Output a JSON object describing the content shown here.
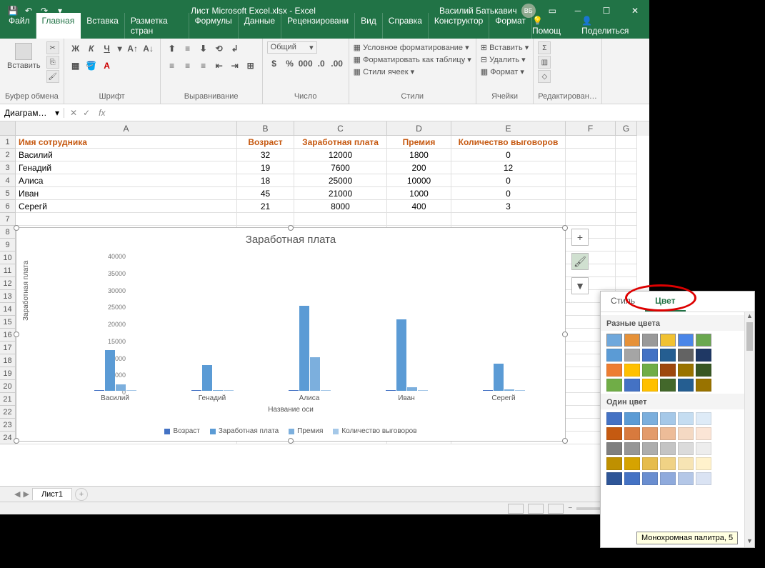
{
  "titlebar": {
    "title": "Лист Microsoft Excel.xlsx - Excel",
    "user": "Василий Батькавич",
    "initials": "ВБ"
  },
  "tabs": {
    "items": [
      "Файл",
      "Главная",
      "Вставка",
      "Разметка стран",
      "Формулы",
      "Данные",
      "Рецензировани",
      "Вид",
      "Справка",
      "Конструктор",
      "Формат"
    ],
    "active": 1,
    "help": "Помощ",
    "share": "Поделиться"
  },
  "ribbon": {
    "g1_paste": "Вставить",
    "g1": "Буфер обмена",
    "g2": "Шрифт",
    "g3": "Выравнивание",
    "g4_name": "Общий",
    "g4": "Число",
    "g5_a": "Условное форматирование",
    "g5_b": "Форматировать как таблицу",
    "g5_c": "Стили ячеек",
    "g5": "Стили",
    "g6_a": "Вставить",
    "g6_b": "Удалить",
    "g6_c": "Формат",
    "g6": "Ячейки",
    "g7": "Редактирован…"
  },
  "namebox": "Диаграм…",
  "columns": [
    "A",
    "B",
    "C",
    "D",
    "E",
    "F",
    "G"
  ],
  "headers": [
    "Имя сотрудника",
    "Возраст",
    "Заработная плата",
    "Премия",
    "Количество выговоров"
  ],
  "rows": [
    {
      "n": "Василий",
      "a": 32,
      "s": 12000,
      "b": 1800,
      "r": 0
    },
    {
      "n": "Генадий",
      "a": 19,
      "s": 7600,
      "b": 200,
      "r": 12
    },
    {
      "n": "Алиса",
      "a": 18,
      "s": 25000,
      "b": 10000,
      "r": 0
    },
    {
      "n": "Иван",
      "a": 45,
      "s": 21000,
      "b": 1000,
      "r": 0
    },
    {
      "n": "Серегй",
      "a": 21,
      "s": 8000,
      "b": 400,
      "r": 3
    }
  ],
  "chart_data": {
    "type": "bar",
    "title": "Заработная плата",
    "categories": [
      "Василий",
      "Генадий",
      "Алиса",
      "Иван",
      "Серегй"
    ],
    "series": [
      {
        "name": "Возраст",
        "values": [
          32,
          19,
          18,
          45,
          21
        ]
      },
      {
        "name": "Заработная плата",
        "values": [
          12000,
          7600,
          25000,
          21000,
          8000
        ]
      },
      {
        "name": "Премия",
        "values": [
          1800,
          200,
          10000,
          1000,
          400
        ]
      },
      {
        "name": "Количество выговоров",
        "values": [
          0,
          12,
          0,
          0,
          3
        ]
      }
    ],
    "xlabel": "Название оси",
    "ylabel": "Заработная плата",
    "yticks": [
      0,
      5000,
      10000,
      15000,
      20000,
      25000,
      30000,
      35000,
      40000
    ],
    "ylim": [
      0,
      40000
    ]
  },
  "sheet": "Лист1",
  "colorpanel": {
    "tab_style": "Стиль",
    "tab_color": "Цвет",
    "lbl_multi": "Разные цвета",
    "lbl_single": "Один цвет",
    "tooltip": "Монохромная палитра, 5",
    "multi": [
      [
        "#6fa8dc",
        "#e69138",
        "#999999",
        "#f1c232",
        "#4a86e8",
        "#6aa84f"
      ],
      [
        "#5b9bd5",
        "#a5a5a5",
        "#4472c4",
        "#255e91",
        "#636363",
        "#1f3864"
      ],
      [
        "#ed7d31",
        "#ffc000",
        "#70ad47",
        "#9e480e",
        "#997300",
        "#385723"
      ],
      [
        "#70ad47",
        "#4472c4",
        "#ffc000",
        "#43682b",
        "#255e91",
        "#997300"
      ]
    ],
    "single": [
      [
        "#4472c4",
        "#5b9bd5",
        "#7cafdd",
        "#a5c8e8",
        "#c5ddf1",
        "#deebf7"
      ],
      [
        "#c55a11",
        "#d87a3e",
        "#e39b6b",
        "#edbc98",
        "#f4d9c3",
        "#fbe5d6"
      ],
      [
        "#7f7f7f",
        "#969696",
        "#adadad",
        "#c4c4c4",
        "#dbdbdb",
        "#ededed"
      ],
      [
        "#bf9000",
        "#d6a300",
        "#e6bc4d",
        "#f0d285",
        "#f7e4b4",
        "#fff2cc"
      ],
      [
        "#2e5597",
        "#4472c4",
        "#6a8ed0",
        "#8faadc",
        "#b4c7e7",
        "#dae3f3"
      ]
    ]
  }
}
